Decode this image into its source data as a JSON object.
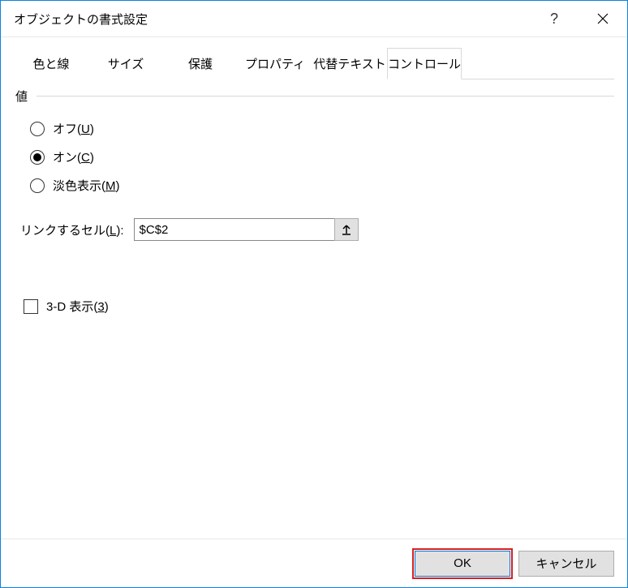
{
  "titlebar": {
    "title": "オブジェクトの書式設定",
    "help_symbol": "?",
    "close_label": "×"
  },
  "tabs": [
    {
      "label": "色と線",
      "active": false
    },
    {
      "label": "サイズ",
      "active": false
    },
    {
      "label": "保護",
      "active": false
    },
    {
      "label": "プロパティ",
      "active": false
    },
    {
      "label": "代替テキスト",
      "active": false
    },
    {
      "label": "コントロール",
      "active": true
    }
  ],
  "group": {
    "value_label": "値",
    "radios": {
      "off": {
        "text": "オフ(",
        "accel": "U",
        "suffix": ")",
        "checked": false
      },
      "on": {
        "text": "オン(",
        "accel": "C",
        "suffix": ")",
        "checked": true
      },
      "gray": {
        "text": "淡色表示(",
        "accel": "M",
        "suffix": ")",
        "checked": false
      }
    },
    "link_cell": {
      "label_prefix": "リンクするセル(",
      "accel": "L",
      "label_suffix": "):",
      "value": "$C$2"
    },
    "threed": {
      "text": "3-D 表示(",
      "accel": "3",
      "suffix": ")",
      "checked": false
    }
  },
  "buttons": {
    "ok": "OK",
    "cancel": "キャンセル"
  }
}
